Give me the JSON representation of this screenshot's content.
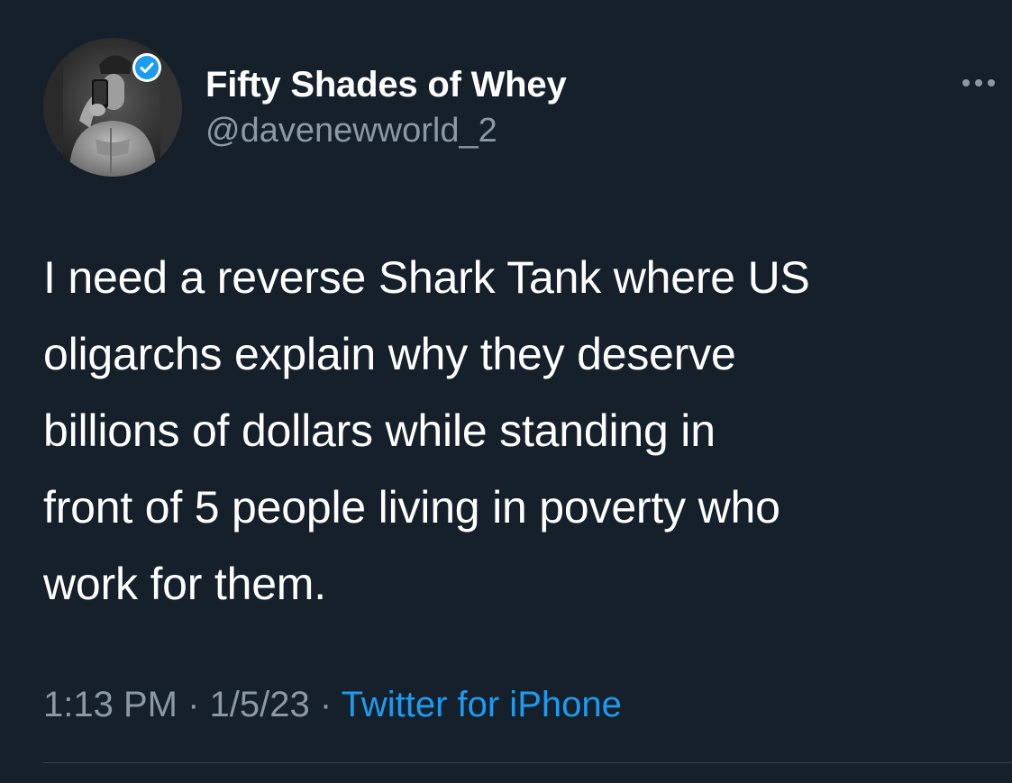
{
  "tweet": {
    "display_name": "Fifty Shades of Whey",
    "handle": "@davenewworld_2",
    "verified": true,
    "text_lines": [
      "I need a reverse Shark Tank where US",
      "oligarchs explain why they deserve",
      "billions of dollars while standing in",
      "front of 5 people living in poverty who",
      "work for them."
    ],
    "time": "1:13 PM",
    "separator": "·",
    "date": "1/5/23",
    "source": "Twitter for iPhone"
  },
  "icons": {
    "more": "more-horizontal-icon",
    "verified": "verified-badge-icon"
  },
  "colors": {
    "background": "#15202b",
    "text_primary": "#ffffff",
    "text_secondary": "#8b98a5",
    "accent": "#1d9bf0",
    "divider": "#38444d"
  }
}
